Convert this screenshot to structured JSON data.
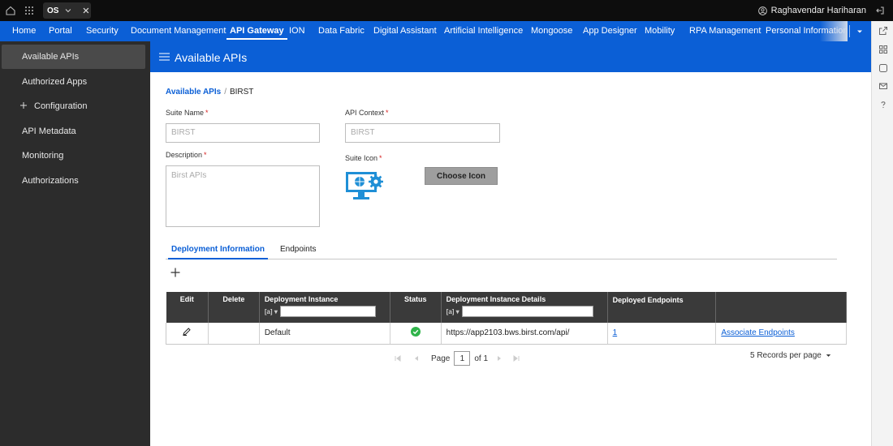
{
  "topbar": {
    "tenant_code": "OS",
    "user_name": "Raghavendar Hariharan"
  },
  "nav": {
    "items": [
      {
        "label": "Home"
      },
      {
        "label": "Portal"
      },
      {
        "label": "Security"
      },
      {
        "label": "Document Management"
      },
      {
        "label": "API Gateway",
        "active": true
      },
      {
        "label": "ION"
      },
      {
        "label": "Data Fabric"
      },
      {
        "label": "Digital Assistant"
      },
      {
        "label": "Artificial Intelligence"
      },
      {
        "label": "Mongoose"
      },
      {
        "label": "App Designer"
      },
      {
        "label": "Mobility"
      },
      {
        "label": "RPA Management"
      },
      {
        "label": "Personal Information"
      }
    ]
  },
  "sidebar": {
    "items": [
      {
        "label": "Available APIs",
        "active": true
      },
      {
        "label": "Authorized Apps"
      },
      {
        "label": "Configuration",
        "expandable": true
      },
      {
        "label": "API Metadata"
      },
      {
        "label": "Monitoring"
      },
      {
        "label": "Authorizations"
      }
    ]
  },
  "header": {
    "title": "Available APIs"
  },
  "breadcrumb": {
    "parent": "Available APIs",
    "separator": "/",
    "current": "BIRST"
  },
  "form": {
    "suite_name_label": "Suite Name",
    "suite_name_placeholder": "BIRST",
    "api_context_label": "API Context",
    "api_context_placeholder": "BIRST",
    "description_label": "Description",
    "description_placeholder": "Birst APIs",
    "suite_icon_label": "Suite Icon",
    "choose_icon_label": "Choose Icon",
    "required_marker": "*"
  },
  "tabs": [
    {
      "label": "Deployment Information",
      "active": true
    },
    {
      "label": "Endpoints"
    }
  ],
  "table": {
    "headers": {
      "edit": "Edit",
      "delete": "Delete",
      "instance": "Deployment Instance",
      "status": "Status",
      "details": "Deployment Instance Details",
      "endpoints": "Deployed Endpoints",
      "filter_op": "[a]"
    },
    "rows": [
      {
        "instance": "Default",
        "status": "active",
        "details": "https://app2103.bws.birst.com/api/",
        "endpoints": "1",
        "action": "Associate Endpoints"
      }
    ]
  },
  "pager": {
    "page_label": "Page",
    "page_value": "1",
    "of_label": "of 1",
    "records_label": "5 Records per page"
  },
  "colors": {
    "brand_blue": "#0b5fd6",
    "sidebar_bg": "#2c2c2c",
    "status_green": "#2fb34a"
  }
}
